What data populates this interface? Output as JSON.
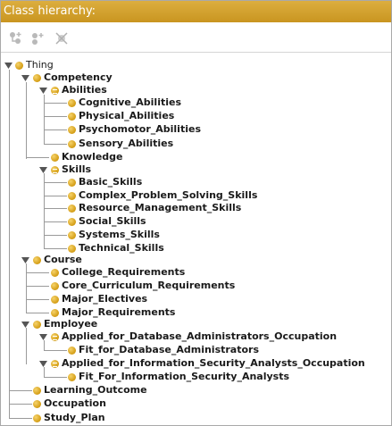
{
  "panel": {
    "title": "Class hierarchy:"
  },
  "toolbar": {
    "buttons": [
      {
        "name": "add-subclass-button",
        "icon": "add-subclass-icon"
      },
      {
        "name": "add-sibling-button",
        "icon": "add-sibling-icon"
      },
      {
        "name": "delete-class-button",
        "icon": "delete-class-icon"
      }
    ]
  },
  "colors": {
    "title_bar": "#c99520",
    "class_dot": "#e2ae2a",
    "tree_line": "#9a9a9a"
  },
  "tree": {
    "thing": "Thing",
    "competency": "Competency",
    "abilities": "Abilities",
    "cognitive_abilities": "Cognitive_Abilities",
    "physical_abilities": "Physical_Abilities",
    "psychomotor_abilities": "Psychomotor_Abilities",
    "sensory_abilities": "Sensory_Abilities",
    "knowledge": "Knowledge",
    "skills": "Skills",
    "basic_skills": "Basic_Skills",
    "complex_problem_solving_skills": "Complex_Problem_Solving_Skills",
    "resource_management_skills": "Resource_Management_Skills",
    "social_skills": "Social_Skills",
    "systems_skills": "Systems_Skills",
    "technical_skills": "Technical_Skills",
    "course": "Course",
    "college_requirements": "College_Requirements",
    "core_curriculum_requirements": "Core_Curriculum_Requirements",
    "major_electives": "Major_Electives",
    "major_requirements": "Major_Requirements",
    "employee": "Employee",
    "applied_dba_occupation": "Applied_for_Database_Administrators_Occupation",
    "fit_dba": "Fit_for_Database_Administrators",
    "applied_isa_occupation": "Applied_for_Information_Security_Analysts_Occupation",
    "fit_isa": "Fit_For_Information_Security_Analysts",
    "learning_outcome": "Learning_Outcome",
    "occupation": "Occupation",
    "study_plan": "Study_Plan"
  }
}
